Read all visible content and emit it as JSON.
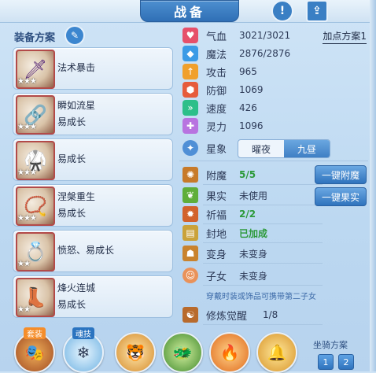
{
  "header": {
    "title": "战备",
    "info_icon": "exclamation-icon",
    "share_icon": "share-icon"
  },
  "left": {
    "scheme_title": "装备方案",
    "edit_icon": "pencil-icon",
    "items": [
      {
        "name": "法术暴击",
        "sub": "",
        "stars": "★★★",
        "art": "🗡"
      },
      {
        "name": "瞬如流星",
        "sub": "易成长",
        "stars": "★★★",
        "art": "🔗"
      },
      {
        "name": "",
        "sub": "易成长",
        "stars": "★★★",
        "art": "🥋"
      },
      {
        "name": "涅槃重生",
        "sub": "易成长",
        "stars": "★★★",
        "art": "📿"
      },
      {
        "name": "愤怒、易成长",
        "sub": "",
        "stars": "★★",
        "art": "💍"
      },
      {
        "name": "烽火连城",
        "sub": "易成长",
        "stars": "★★",
        "art": "👢"
      }
    ]
  },
  "right": {
    "add_plan": "加点方案1",
    "attrs": [
      {
        "label": "气血",
        "value": "3021/3021",
        "color": "#e6506a",
        "glyph": "♥"
      },
      {
        "label": "魔法",
        "value": "2876/2876",
        "color": "#3b9be6",
        "glyph": "◆"
      },
      {
        "label": "攻击",
        "value": "965",
        "color": "#f0a02c",
        "glyph": "↑"
      },
      {
        "label": "防御",
        "value": "1069",
        "color": "#e65c3c",
        "glyph": "⬢"
      },
      {
        "label": "速度",
        "value": "426",
        "color": "#2dbf8a",
        "glyph": "»"
      },
      {
        "label": "灵力",
        "value": "1096",
        "color": "#b873e0",
        "glyph": "✚"
      }
    ],
    "star": {
      "label": "星象",
      "opt1": "曜夜",
      "opt2": "九昼",
      "active": "opt2"
    },
    "bonus": [
      {
        "label": "附魔",
        "value": "5/5",
        "green": true
      },
      {
        "label": "果实",
        "value": "未使用",
        "green": false
      },
      {
        "label": "祈福",
        "value": "2/2",
        "green": true
      },
      {
        "label": "封地",
        "value": "已加成",
        "green": true
      },
      {
        "label": "变身",
        "value": "未变身",
        "green": false
      },
      {
        "label": "子女",
        "value": "未变身",
        "green": false
      }
    ],
    "btn_enchant": "一键附魔",
    "btn_fruit": "一键果实",
    "note": "穿戴时装或饰品可携带第二子女",
    "awaken": {
      "label": "修炼觉醒",
      "value": "1/8"
    }
  },
  "bottom": {
    "slots": [
      {
        "tag": "套装",
        "art": "🎭"
      },
      {
        "tag": "魂技",
        "art": "❄"
      },
      {
        "tag": "",
        "art": "🐯"
      },
      {
        "tag": "",
        "art": "🐲"
      },
      {
        "tag": "",
        "art": "🔥"
      },
      {
        "tag": "",
        "art": "🔔"
      }
    ],
    "ride_title": "坐骑方案",
    "ride_1": "1",
    "ride_2": "2"
  }
}
